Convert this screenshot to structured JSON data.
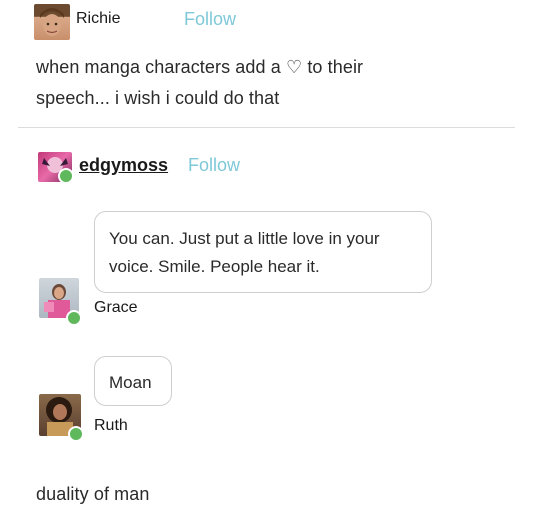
{
  "post": {
    "user": {
      "name": "Richie",
      "follow_label": "Follow"
    },
    "text_line1": "when manga characters add a",
    "heart_symbol": "♡",
    "text_line1_end": "to their",
    "text_line2": "speech... i wish i could do that"
  },
  "reblog": {
    "user": {
      "name": "edgymoss",
      "follow_label": "Follow"
    },
    "messages": [
      {
        "speaker": "Grace",
        "text_line1": "You can. Just put a little love in your",
        "text_line2": "voice. Smile. People hear it."
      },
      {
        "speaker": "Ruth",
        "text": "Moan"
      }
    ],
    "caption": "duality of man"
  },
  "colors": {
    "follow": "#7ec8d8",
    "badge_green": "#5fb85b",
    "divider": "#dcdcdc"
  }
}
